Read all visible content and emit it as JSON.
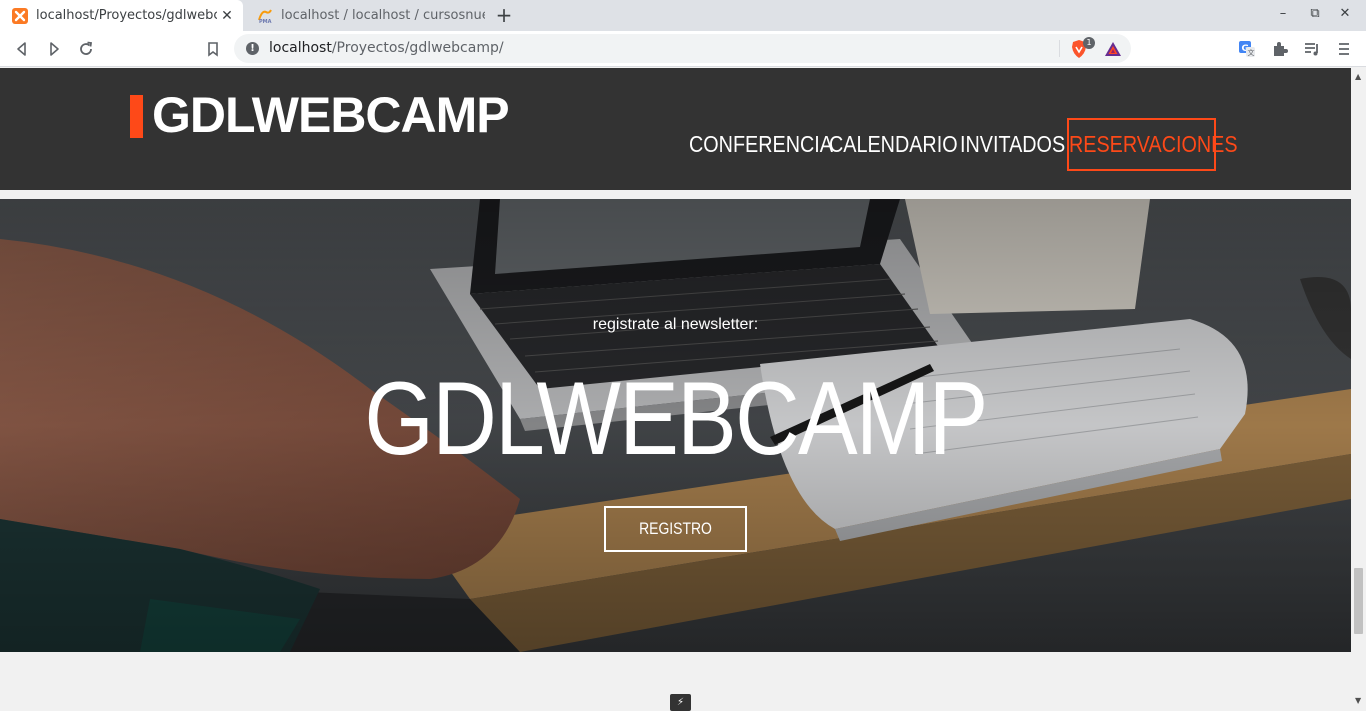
{
  "browser": {
    "tabs": [
      {
        "title": "localhost/Proyectos/gdlwebcamp/",
        "close": "✕",
        "favicon": "xampp-favicon"
      },
      {
        "title": "localhost / localhost / cursosnuevo",
        "favicon": "phpmyadmin-favicon"
      }
    ],
    "new_tab": "+",
    "window_controls": {
      "minimize": "–",
      "restore": "⧉",
      "close": "✕"
    },
    "address": {
      "host": "localhost",
      "path": "/Proyectos/gdlwebcamp/"
    },
    "shields_badge": "1"
  },
  "site": {
    "logo": "GDLWEBCAMP",
    "nav": [
      "CONFERENCIA",
      "CALENDARIO",
      "INVITADOS"
    ],
    "nav_highlight": "RESERVACIONES",
    "accent_color": "#fe4918",
    "header_color": "#333333"
  },
  "hero": {
    "subtitle": "registrate al newsletter:",
    "title": "GDLWEBCAMP",
    "button": "REGISTRO"
  }
}
